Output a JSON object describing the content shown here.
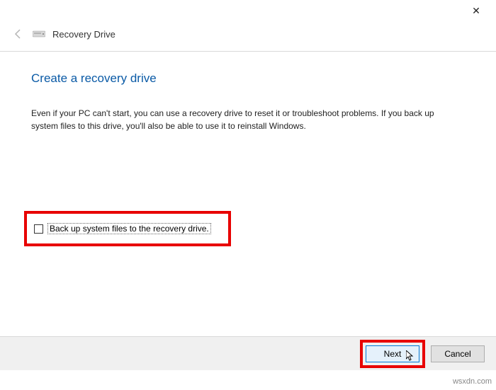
{
  "titlebar": {
    "close_label": "✕"
  },
  "header": {
    "title": "Recovery Drive"
  },
  "content": {
    "heading": "Create a recovery drive",
    "description": "Even if your PC can't start, you can use a recovery drive to reset it or troubleshoot problems. If you back up system files to this drive, you'll also be able to use it to reinstall Windows."
  },
  "checkbox": {
    "label": "Back up system files to the recovery drive."
  },
  "footer": {
    "next": "Next",
    "cancel": "Cancel"
  },
  "watermark": "wsxdn.com"
}
